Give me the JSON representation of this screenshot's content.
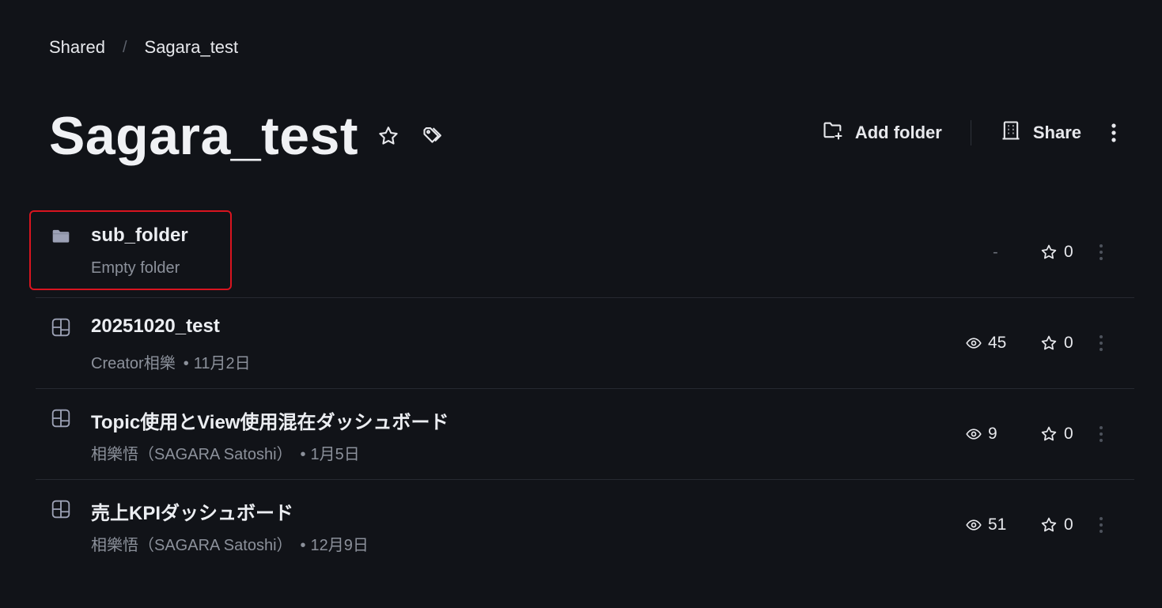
{
  "breadcrumb": {
    "items": [
      "Shared",
      "Sagara_test"
    ],
    "separator": "/"
  },
  "header": {
    "title": "Sagara_test",
    "add_folder_label": "Add folder",
    "share_label": "Share"
  },
  "items": [
    {
      "type": "folder",
      "title": "sub_folder",
      "subtitle": "Empty folder",
      "views": "-",
      "stars": "0"
    },
    {
      "type": "dashboard",
      "title": "20251020_test",
      "owner": "Creator相樂",
      "date": "11月2日",
      "views": "45",
      "stars": "0"
    },
    {
      "type": "dashboard",
      "title": "Topic使用とView使用混在ダッシュボード",
      "owner": "相樂悟（SAGARA Satoshi）",
      "date": "1月5日",
      "views": "9",
      "stars": "0"
    },
    {
      "type": "dashboard",
      "title": "売上KPIダッシュボード",
      "owner": "相樂悟（SAGARA Satoshi）",
      "date": "12月9日",
      "views": "51",
      "stars": "0"
    }
  ],
  "colors": {
    "background": "#111318",
    "text": "#e7e8ec",
    "muted": "#8c919b",
    "highlight": "#d9141f"
  }
}
